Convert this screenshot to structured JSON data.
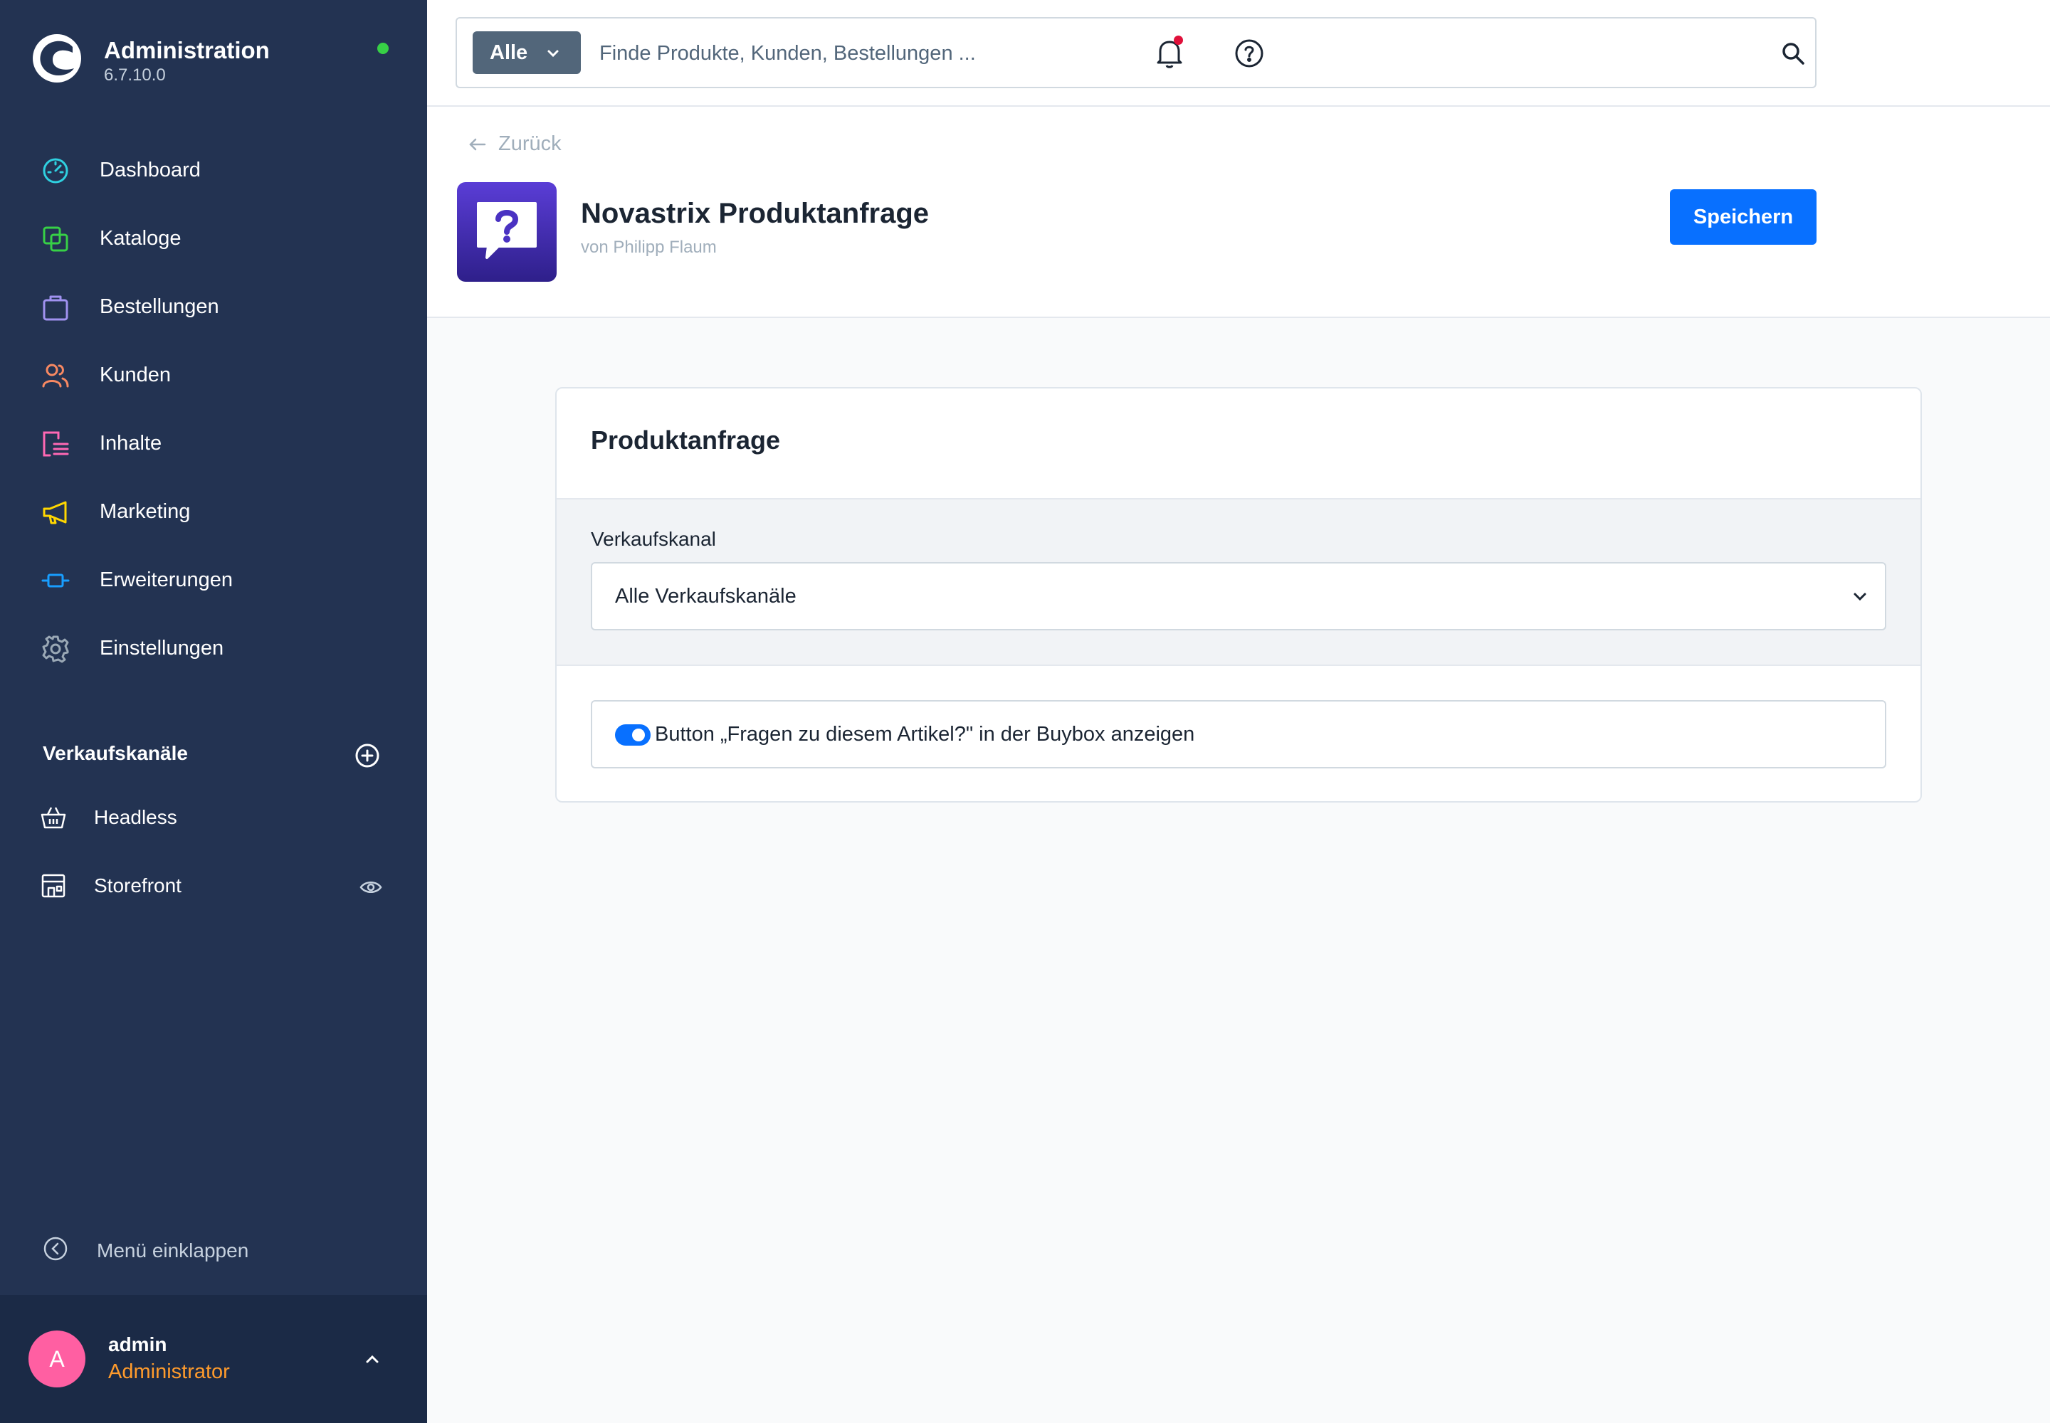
{
  "colors": {
    "sidebar_bg": "#233352",
    "user_box_bg": "#1b2a46",
    "primary": "#0870ff",
    "status_online": "#37d046",
    "notification_dot": "#e0103a",
    "avatar_bg": "#ff5fa2",
    "role_color": "#ff9b2c"
  },
  "brand": {
    "title": "Administration",
    "version": "6.7.10.0",
    "logo_icon": "shopware-logo-icon"
  },
  "nav": {
    "items": [
      {
        "label": "Dashboard",
        "icon": "gauge-icon",
        "color": "#2fd0e0"
      },
      {
        "label": "Kataloge",
        "icon": "catalog-icon",
        "color": "#37d046"
      },
      {
        "label": "Bestellungen",
        "icon": "shopping-bag-icon",
        "color": "#a092f0"
      },
      {
        "label": "Kunden",
        "icon": "users-icon",
        "color": "#f88962"
      },
      {
        "label": "Inhalte",
        "icon": "content-icon",
        "color": "#ff68b4"
      },
      {
        "label": "Marketing",
        "icon": "megaphone-icon",
        "color": "#ffd700"
      },
      {
        "label": "Erweiterungen",
        "icon": "plug-icon",
        "color": "#189eff"
      },
      {
        "label": "Einstellungen",
        "icon": "gear-icon",
        "color": "#9aa8b5"
      }
    ]
  },
  "sales_channels": {
    "title": "Verkaufskanäle",
    "add_icon": "plus-circle-icon",
    "items": [
      {
        "label": "Headless",
        "icon": "basket-icon"
      },
      {
        "label": "Storefront",
        "icon": "storefront-icon",
        "action_icon": "eye-icon"
      }
    ]
  },
  "collapse_menu": {
    "label": "Menü einklappen",
    "icon": "chevron-left-circle-icon"
  },
  "user": {
    "initial": "A",
    "name": "admin",
    "role": "Administrator"
  },
  "search": {
    "scope": "Alle",
    "placeholder": "Finde Produkte, Kunden, Bestellungen ..."
  },
  "header": {
    "back_label": "Zurück",
    "plugin_name": "Novastrix Produktanfrage",
    "plugin_author": "von Philipp Flaum",
    "save_label": "Speichern"
  },
  "card": {
    "title": "Produktanfrage",
    "sales_channel_label": "Verkaufskanal",
    "sales_channel_value": "Alle Verkaufskanäle",
    "toggle_label": "Button „Fragen zu diesem Artikel?\" in der Buybox anzeigen",
    "toggle_on": true
  }
}
